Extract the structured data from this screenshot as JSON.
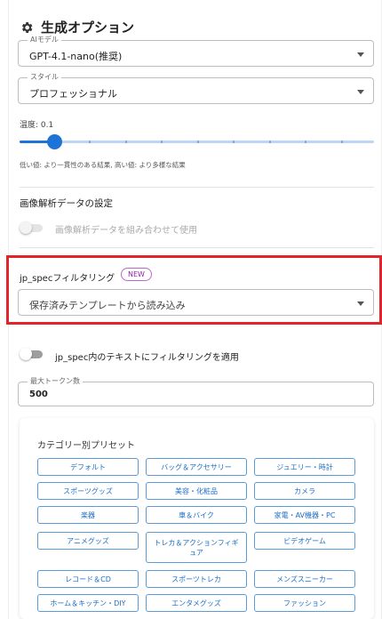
{
  "header": {
    "title": "生成オプション",
    "icon": "gear-icon"
  },
  "model_select": {
    "legend": "AIモデル",
    "value": "GPT-4.1-nano(推奨)"
  },
  "style_select": {
    "legend": "スタイル",
    "value": "プロフェッショナル"
  },
  "temperature": {
    "label": "温度: 0.1",
    "value": 0.1,
    "hint": "低い値: より一貫性のある結果, 高い値: より多様な結果"
  },
  "image_analysis": {
    "heading": "画像解析データの設定",
    "toggle_label": "画像解析データを組み合わせて使用",
    "enabled": false
  },
  "jp_spec": {
    "heading": "jp_specフィルタリング",
    "badge": "NEW",
    "template_placeholder": "保存済みテンプレートから読み込み",
    "toggle_label": "jp_spec内のテキストにフィルタリングを適用",
    "enabled": false
  },
  "max_tokens": {
    "legend": "最大トークン数",
    "value": "500"
  },
  "presets": {
    "heading": "カテゴリー別プリセット",
    "items": [
      "デフォルト",
      "バッグ＆アクセサリー",
      "ジュエリー・時計",
      "スポーツグッズ",
      "美容・化粧品",
      "カメラ",
      "楽器",
      "車＆バイク",
      "家電・AV機器・PC",
      "アニメグッズ",
      "トレカ＆アクションフィギュア",
      "ビデオゲーム",
      "レコード＆CD",
      "スポーツトレカ",
      "メンズスニーカー",
      "ホーム＆キッチン・DIY",
      "エンタメグッズ",
      "ファッション"
    ]
  },
  "colors": {
    "accent": "#1e73d6",
    "highlight_border": "#e3242b",
    "badge": "#8e24aa"
  }
}
